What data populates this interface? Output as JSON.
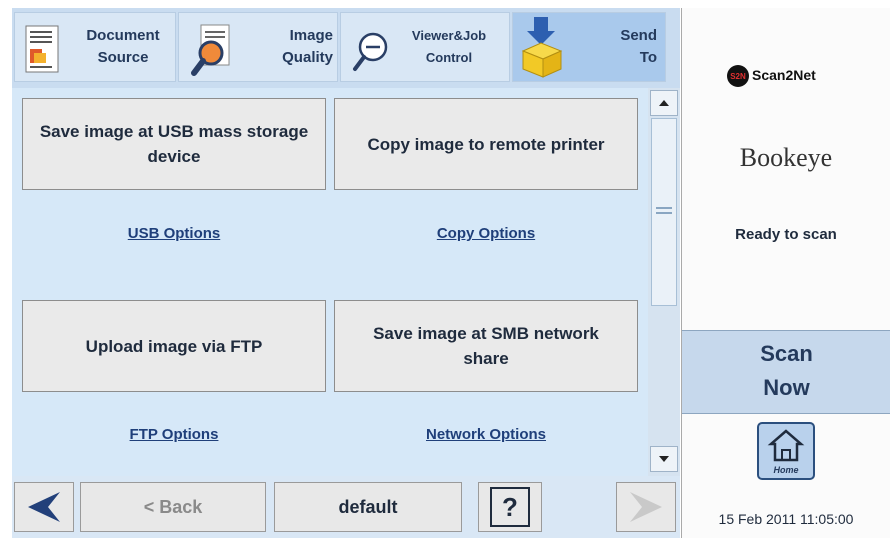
{
  "tabs": [
    {
      "line1": "Document",
      "line2": "Source",
      "icon": "document-icon"
    },
    {
      "line1": "Image",
      "line2": "Quality",
      "icon": "magnifier-icon"
    },
    {
      "line1": "Viewer&Job",
      "line2": "Control",
      "icon": "zoom-icon"
    },
    {
      "line1": "Send",
      "line2": "To",
      "icon": "send-box-icon",
      "active": true
    }
  ],
  "actions": [
    {
      "label": "Save image at USB mass storage device",
      "option": "USB Options"
    },
    {
      "label": "Copy image to remote printer",
      "option": "Copy Options"
    },
    {
      "label": "Upload image via FTP",
      "option": "FTP Options"
    },
    {
      "label": "Save image at SMB network share",
      "option": "Network Options"
    }
  ],
  "bottom": {
    "back_label": "< Back",
    "default_label": "default",
    "help_label": "?"
  },
  "right": {
    "brand_scan2net": "Scan2Net",
    "brand_scan2net_badge": "S2N",
    "brand_bookeye": "Bookeye",
    "status": "Ready to scan",
    "scan_line1": "Scan",
    "scan_line2": "Now",
    "home_label": "Home",
    "datetime": "15 Feb 2011 11:05:00"
  },
  "colors": {
    "panel": "#d6e8f8",
    "accent": "#a9c9ec",
    "text": "#1f2b3d",
    "nav_arrow": "#22407a"
  }
}
